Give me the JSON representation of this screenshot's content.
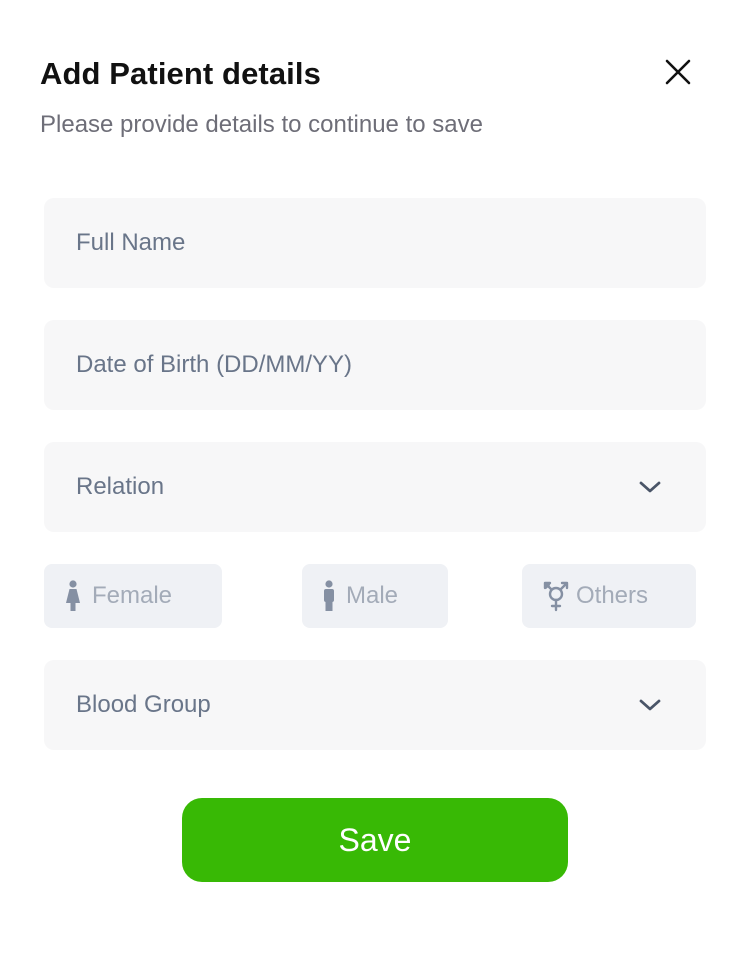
{
  "header": {
    "title": "Add Patient details",
    "subtitle": "Please provide details to continue to save",
    "close_icon": "close-icon"
  },
  "form": {
    "full_name": {
      "placeholder": "Full Name",
      "value": ""
    },
    "date_of_birth": {
      "placeholder": "Date of Birth (DD/MM/YY)",
      "value": ""
    },
    "relation": {
      "label": "Relation",
      "icon": "chevron-down-icon"
    },
    "gender_options": [
      {
        "label": "Female",
        "icon": "female-icon"
      },
      {
        "label": "Male",
        "icon": "male-icon"
      },
      {
        "label": "Others",
        "icon": "transgender-icon"
      }
    ],
    "blood_group": {
      "label": "Blood Group",
      "icon": "chevron-down-icon"
    }
  },
  "actions": {
    "save_label": "Save"
  },
  "colors": {
    "accent": "#38b905",
    "field_background": "#f7f7f8",
    "chip_background": "#eff1f5",
    "placeholder_text": "#697589",
    "chip_text": "#a3abb8"
  }
}
